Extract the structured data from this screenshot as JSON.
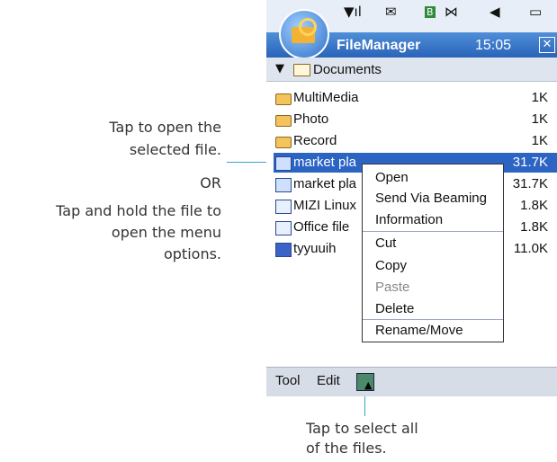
{
  "annotations": {
    "open_line1": "Tap to open the",
    "open_line2": "selected file.",
    "or": "OR",
    "hold_line1": "Tap and hold the file to",
    "hold_line2": "open the menu",
    "hold_line3": "options.",
    "select_line1": "Tap to select all",
    "select_line2": "of the files."
  },
  "statusbar": {
    "icons": [
      "signal-icon",
      "mail-icon",
      "bluetooth-icon",
      "speaker-icon",
      "battery-icon"
    ]
  },
  "titlebar": {
    "app_title": "FileManager",
    "clock": "15:05"
  },
  "pathbar": {
    "folder": "Documents"
  },
  "files": [
    {
      "name": "MultiMedia",
      "size": "1K",
      "icon": "folder-icon"
    },
    {
      "name": "Photo",
      "size": "1K",
      "icon": "folder-icon"
    },
    {
      "name": "Record",
      "size": "1K",
      "icon": "folder-icon"
    },
    {
      "name": "market pla",
      "size": "31.7K",
      "icon": "presentation-icon",
      "selected": true
    },
    {
      "name": "market pla",
      "size": "31.7K",
      "icon": "presentation-icon"
    },
    {
      "name": "MIZI Linux",
      "size": "1.8K",
      "icon": "ppt-icon"
    },
    {
      "name": "Office file",
      "size": "1.8K",
      "icon": "ppt-icon"
    },
    {
      "name": "tyyuuih",
      "size": "11.0K",
      "icon": "word-doc-icon"
    }
  ],
  "context_menu": {
    "items": [
      "Open",
      "Send Via Beaming",
      "Information",
      "Cut",
      "Copy",
      "Paste",
      "Delete",
      "Rename/Move"
    ]
  },
  "toolbar": {
    "tool": "Tool",
    "edit": "Edit"
  }
}
